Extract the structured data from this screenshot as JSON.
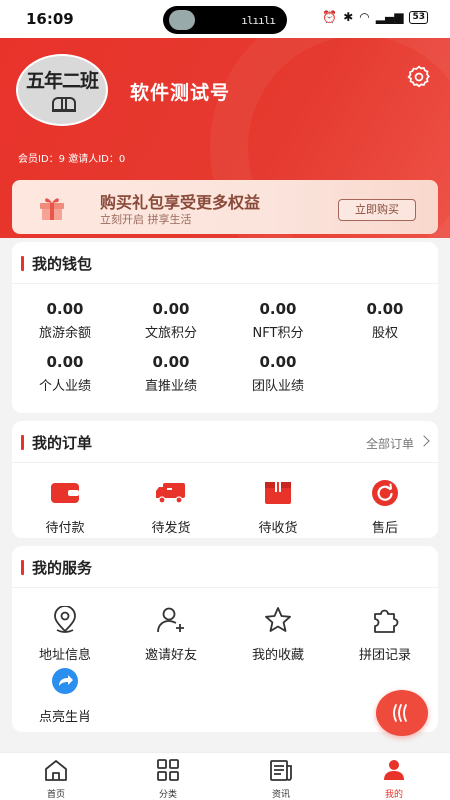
{
  "status_bar": {
    "time": "16:09",
    "battery": "53"
  },
  "profile": {
    "avatar_text": "五年二班",
    "username": "软件测试号",
    "member_ids": "会员ID：9 邀请人ID：0"
  },
  "promo": {
    "title": "购买礼包享受更多权益",
    "subtitle": "立刻开启 拼享生活",
    "button": "立即购买"
  },
  "wallet": {
    "title": "我的钱包",
    "items": [
      {
        "value": "0.00",
        "label": "旅游余额"
      },
      {
        "value": "0.00",
        "label": "文旅积分"
      },
      {
        "value": "0.00",
        "label": "NFT积分"
      },
      {
        "value": "0.00",
        "label": "股权"
      },
      {
        "value": "0.00",
        "label": "个人业绩"
      },
      {
        "value": "0.00",
        "label": "直推业绩"
      },
      {
        "value": "0.00",
        "label": "团队业绩"
      }
    ]
  },
  "orders": {
    "title": "我的订单",
    "all_label": "全部订单",
    "items": [
      {
        "label": "待付款",
        "icon": "wallet-icon"
      },
      {
        "label": "待发货",
        "icon": "truck-icon"
      },
      {
        "label": "待收货",
        "icon": "package-icon"
      },
      {
        "label": "售后",
        "icon": "refresh-icon"
      }
    ]
  },
  "services": {
    "title": "我的服务",
    "items": [
      {
        "label": "地址信息",
        "icon": "location-icon"
      },
      {
        "label": "邀请好友",
        "icon": "add-user-icon"
      },
      {
        "label": "我的收藏",
        "icon": "star-icon"
      },
      {
        "label": "拼团记录",
        "icon": "puzzle-icon"
      },
      {
        "label": "点亮生肖",
        "icon": "share-icon"
      }
    ]
  },
  "nav": {
    "items": [
      {
        "label": "首页",
        "icon": "home-icon"
      },
      {
        "label": "分类",
        "icon": "grid-icon"
      },
      {
        "label": "资讯",
        "icon": "news-icon"
      },
      {
        "label": "我的",
        "icon": "user-icon"
      }
    ],
    "active": "我的"
  },
  "colors": {
    "brand": "#e8332b",
    "promo_text": "#8a4a3a",
    "page_bg": "#f3f3f3"
  }
}
